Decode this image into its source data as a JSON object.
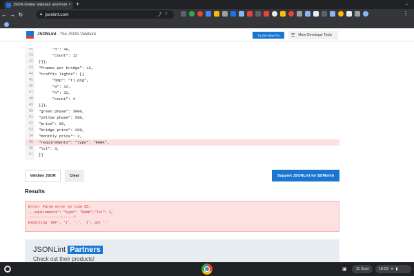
{
  "browser": {
    "tab_title": "JSON Online Validator and Formatter",
    "tab_close": "×",
    "new_tab": "+",
    "url": "jsonlint.com",
    "menu": "⋮"
  },
  "header": {
    "brand": "JSONLint",
    "tagline": "- The JSON Validator",
    "try_button": "Try the New Pro",
    "more_tools": "More Developer Tools"
  },
  "editor": {
    "lines": [
      {
        "num": "40",
        "text": "      \"h\": 48,"
      },
      {
        "num": "41",
        "text": "      \"count\": 12"
      },
      {
        "num": "42",
        "text": "}]},"
      },
      {
        "num": "43",
        "text": "\"frames per bridge\": 12,"
      },
      {
        "num": "44",
        "text": "\"traffic lights\": [{"
      },
      {
        "num": "45",
        "text": "      \"bmp\": \"tl.png\","
      },
      {
        "num": "46",
        "text": "      \"w\": 32,"
      },
      {
        "num": "47",
        "text": "      \"h\": 32,"
      },
      {
        "num": "48",
        "text": "      \"count\": 4"
      },
      {
        "num": "49",
        "text": "}]},"
      },
      {
        "num": "50",
        "text": "\"green phase\": 3000,"
      },
      {
        "num": "51",
        "text": "\"yellow phase\": 500,"
      },
      {
        "num": "52",
        "text": "\"price\": 50,"
      },
      {
        "num": "53",
        "text": "\"bridge price\": 200,"
      },
      {
        "num": "54",
        "text": "\"monthly price\": 2,"
      },
      {
        "num": "55",
        "text": "\"requirements\": \"type\": \"RANK\","
      },
      {
        "num": "56",
        "text": "\"lvl\": 3,"
      },
      {
        "num": "57",
        "text": "}]"
      }
    ],
    "error_line_index": 15
  },
  "buttons": {
    "validate": "Validate JSON",
    "clear": "Clear",
    "support": "Support JSONLint for $2/Month"
  },
  "results": {
    "title": "Results",
    "error_lines": [
      "Error: Parse error on line 55:",
      "...equirements\": \"type\": \"RANK\",\"lvl\": 3,",
      "----------------------^",
      "Expecting 'EOF', '}', ',', ']', got ':'"
    ]
  },
  "partners": {
    "title": "JSONLint",
    "highlight": "Partners",
    "subtitle": "Check out their products!"
  },
  "shelf": {
    "date": "11 Sept",
    "time": "10:23"
  }
}
